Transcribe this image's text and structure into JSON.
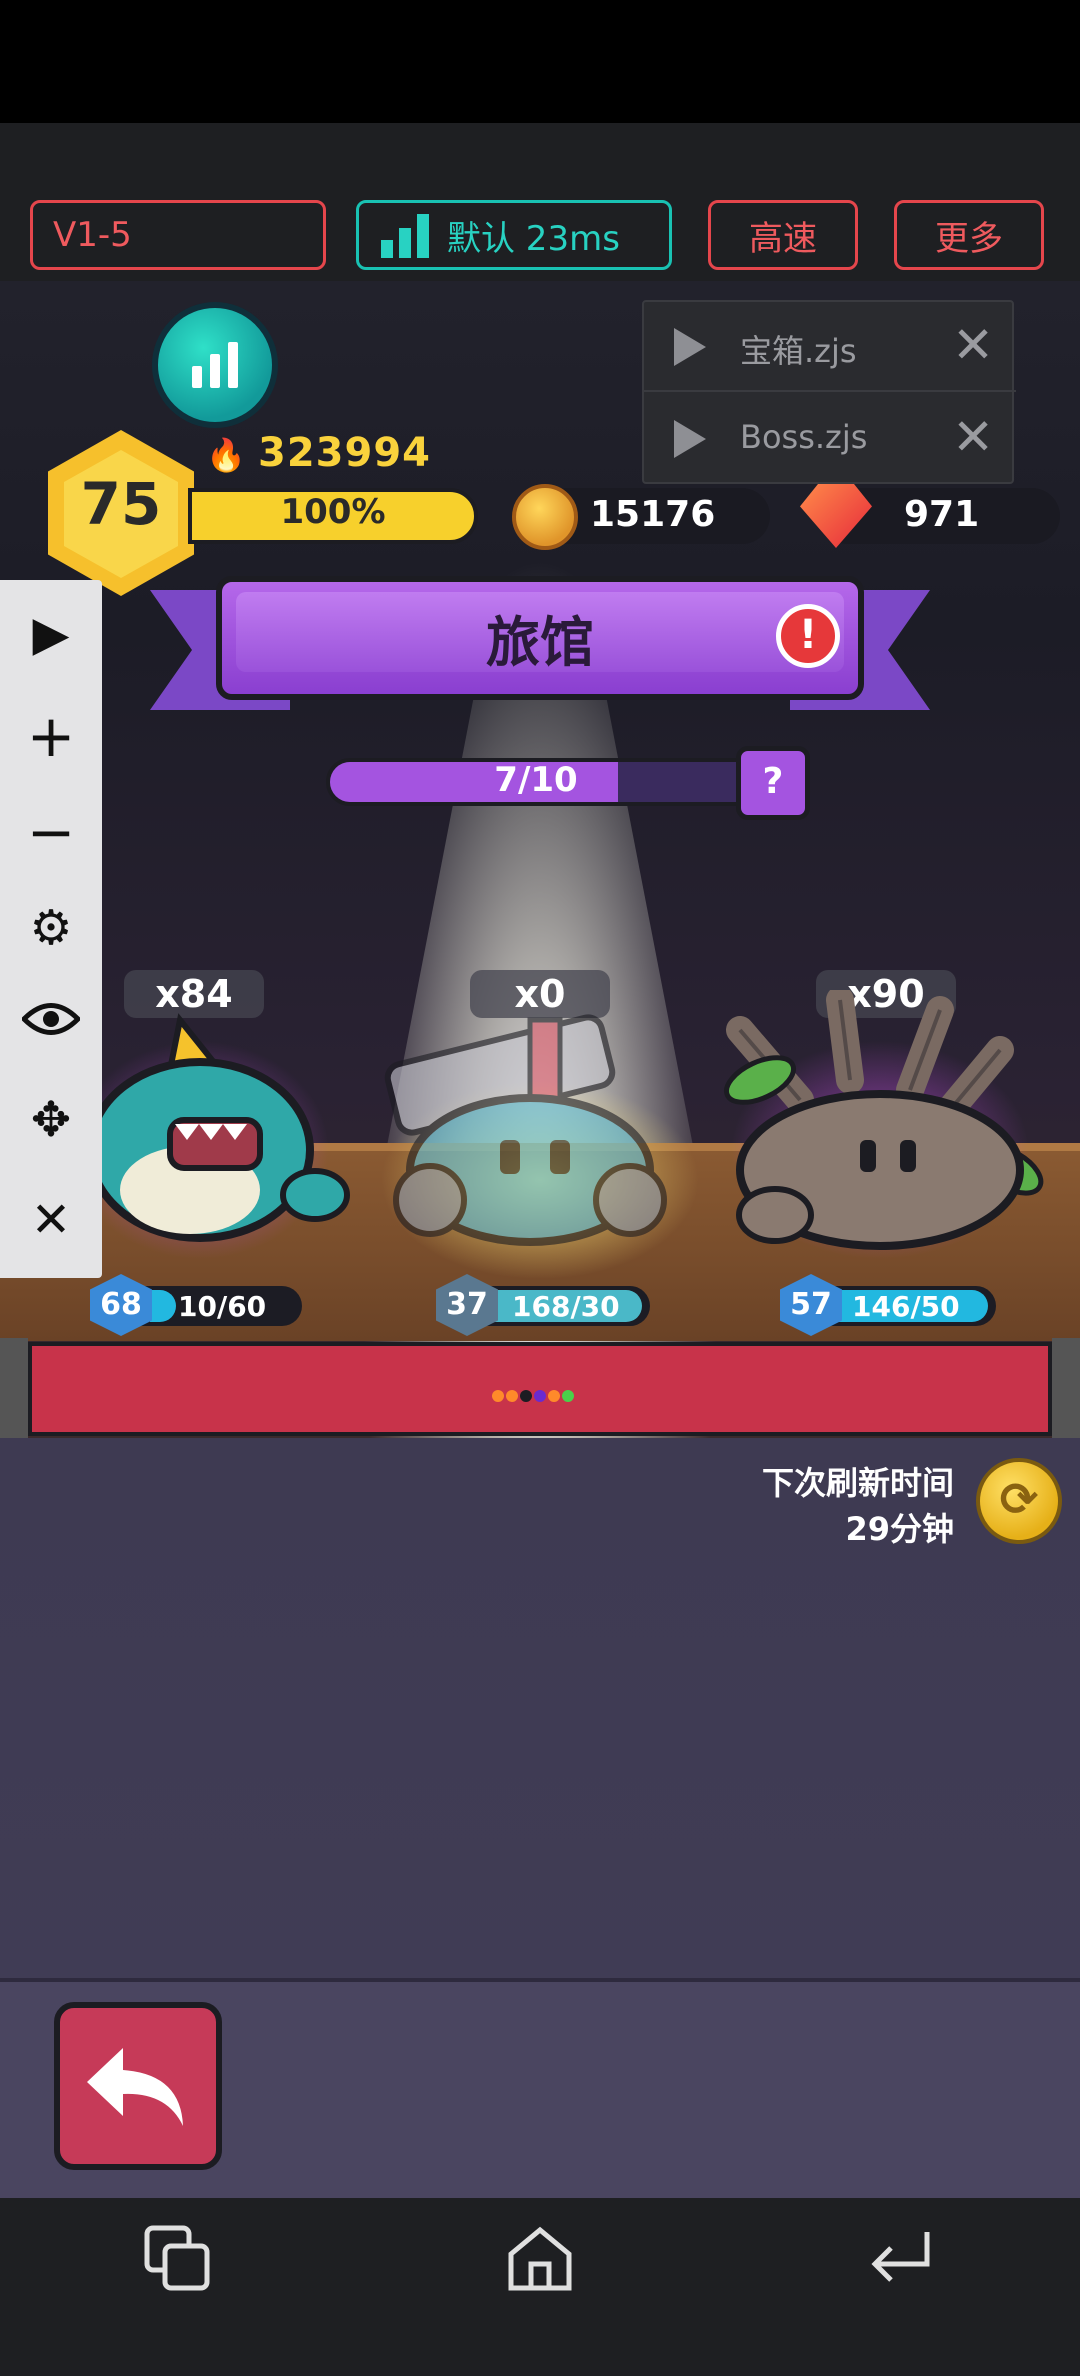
{
  "toolbar": {
    "version_label": "V1-5",
    "network_label": "默认 23ms",
    "speed_label": "高速",
    "more_label": "更多"
  },
  "player": {
    "level": "75",
    "power": "323994",
    "exp_percent_label": "100%",
    "exp_fraction": 1.0,
    "coins": "15176",
    "gems": "971"
  },
  "scripts": [
    {
      "name": "宝箱.zjs"
    },
    {
      "name": "Boss.zjs"
    }
  ],
  "controls": {
    "play_icon": "play-icon",
    "zoom_in_icon": "plus-icon",
    "zoom_out_icon": "minus-icon",
    "settings_icon": "gear-icon",
    "visibility_icon": "eye-icon",
    "move_icon": "move-icon",
    "close_icon": "close-icon"
  },
  "inn": {
    "title": "旅馆",
    "progress_label": "7/10",
    "progress_fraction": 0.7,
    "help_label": "?",
    "alert_label": "!"
  },
  "monsters": [
    {
      "count": "x84",
      "level": "68",
      "hp_label": "10/60",
      "hp_fraction": 0.17
    },
    {
      "count": "x0",
      "level": "37",
      "hp_label": "168/30",
      "hp_fraction": 1.0
    },
    {
      "count": "x90",
      "level": "57",
      "hp_label": "146/50",
      "hp_fraction": 1.0
    }
  ],
  "refresh": {
    "line1": "下次刷新时间",
    "line2": "29分钟"
  },
  "colors": {
    "toolbar_accent": "#e5464c",
    "network_accent": "#19c2b3",
    "banner_purple": "#a454e0",
    "strip_red": "#c8334a",
    "back_button": "#c63a58"
  }
}
